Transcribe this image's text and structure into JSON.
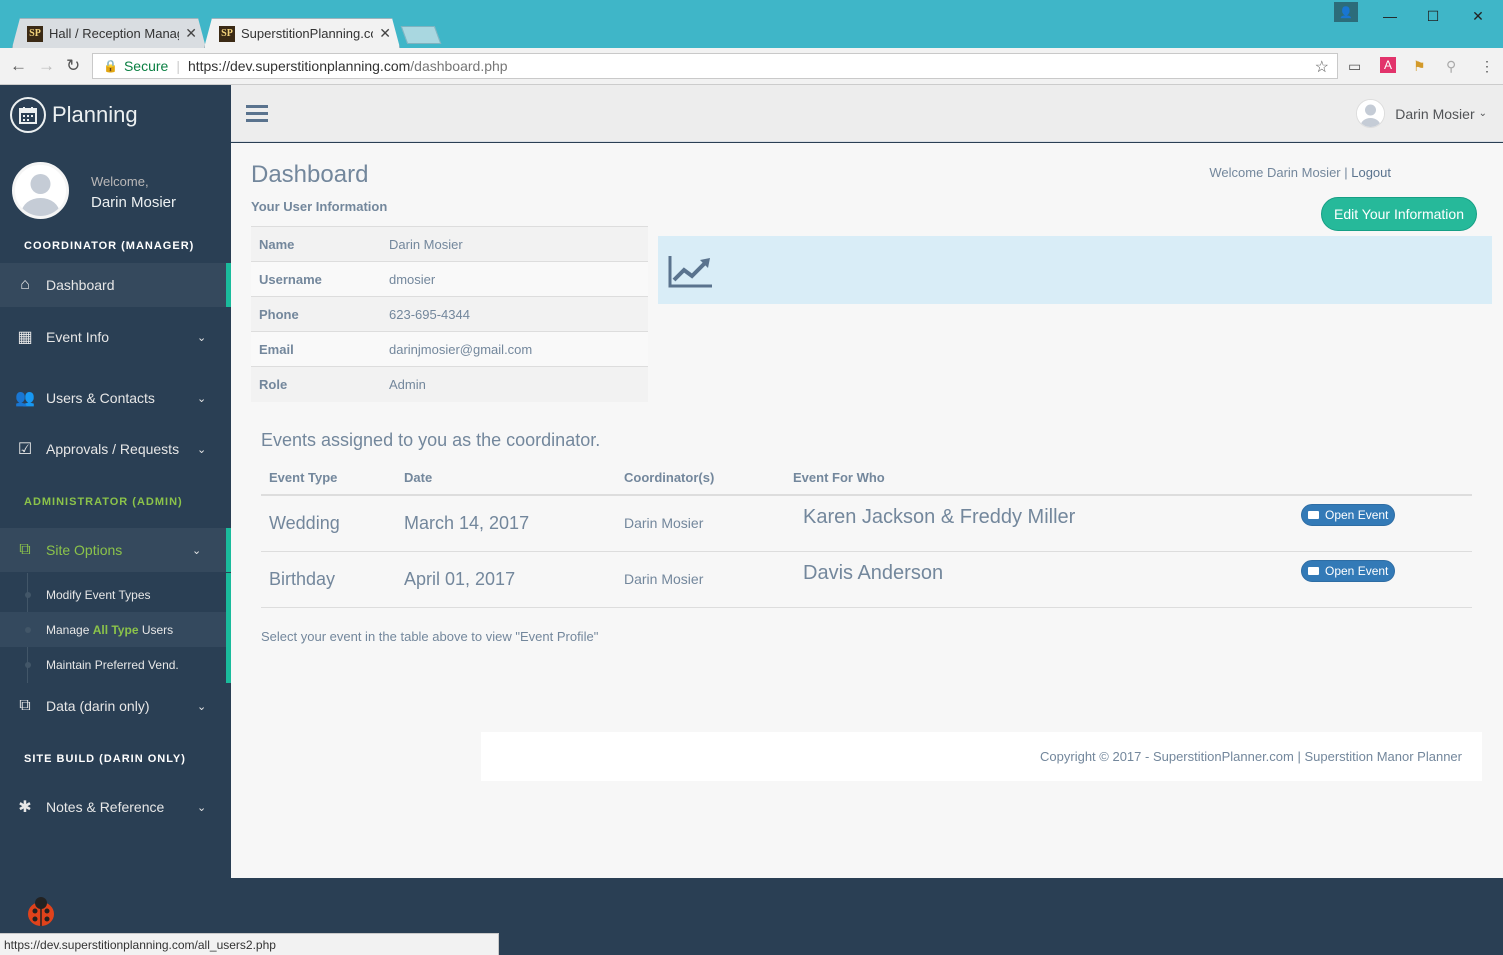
{
  "browser": {
    "tabs": [
      {
        "favicon": "SP",
        "title": "Hall / Reception Manage"
      },
      {
        "favicon": "SP",
        "title": "SuperstitionPlanning.com"
      }
    ],
    "address": {
      "secure_label": "Secure",
      "url_host": "https://dev.superstitionplanning.com",
      "url_path": "/dashboard.php"
    },
    "status_url": "https://dev.superstitionplanning.com/all_users2.php"
  },
  "sidebar": {
    "brand": "Planning",
    "welcome": "Welcome,",
    "user_name": "Darin Mosier",
    "section_coordinator": "COORDINATOR (MANAGER)",
    "section_admin": "ADMINISTRATOR (ADMIN)",
    "section_build": "SITE BUILD (DARIN ONLY)",
    "items": {
      "dashboard": "Dashboard",
      "event_info": "Event Info",
      "users_contacts": "Users & Contacts",
      "approvals": "Approvals / Requests",
      "site_options": "Site Options",
      "data": "Data (darin only)",
      "notes": "Notes & Reference"
    },
    "submenu": {
      "modify_event_types": "Modify Event Types",
      "manage_prefix": "Manage ",
      "manage_highlight": "All Type",
      "manage_suffix": " Users",
      "preferred_vend": "Maintain Preferred Vend."
    }
  },
  "topnav": {
    "user_name": "Darin Mosier"
  },
  "main": {
    "title": "Dashboard",
    "subtitle": "Your User Information",
    "welcome_text": "Welcome Darin Mosier | ",
    "logout": "Logout",
    "edit_button": "Edit Your Information",
    "user_info": [
      {
        "key": "Name",
        "value": "Darin Mosier"
      },
      {
        "key": "Username",
        "value": "dmosier"
      },
      {
        "key": "Phone",
        "value": "623-695-4344"
      },
      {
        "key": "Email",
        "value": "darinjmosier@gmail.com"
      },
      {
        "key": "Role",
        "value": "Admin"
      }
    ],
    "events_heading": "Events assigned to you as the coordinator.",
    "events_columns": [
      "Event Type",
      "Date",
      "Coordinator(s)",
      "Event For Who"
    ],
    "events": [
      {
        "type": "Wedding",
        "date": "March 14, 2017",
        "coordinator": "Darin Mosier",
        "for_who": "Karen Jackson & Freddy Miller",
        "action": "Open Event"
      },
      {
        "type": "Birthday",
        "date": "April 01, 2017",
        "coordinator": "Darin Mosier",
        "for_who": "Davis Anderson",
        "action": "Open Event"
      }
    ],
    "hint": "Select your event in the table above to view \"Event Profile\"",
    "footer": "Copyright © 2017 - SuperstitionPlanner.com | Superstition Manor Planner"
  },
  "colors": {
    "sidebar_bg": "#2a3f54",
    "accent_green": "#26b99a",
    "admin_green": "#8bc34a",
    "button_blue": "#337ab7",
    "banner_blue": "#d9edf7"
  }
}
